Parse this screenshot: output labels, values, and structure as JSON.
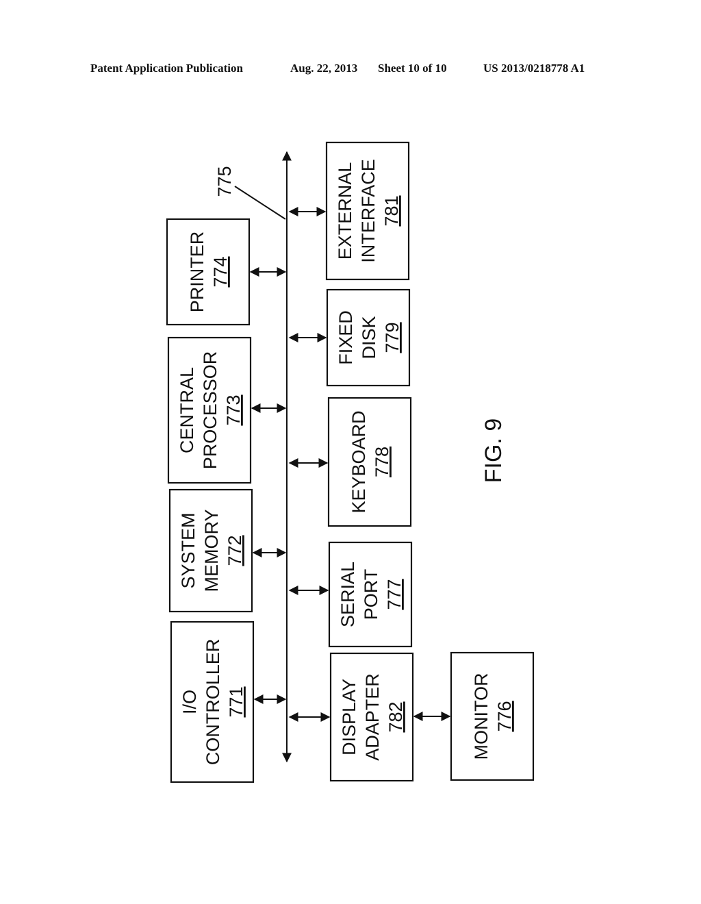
{
  "header": {
    "publication": "Patent Application Publication",
    "date": "Aug. 22, 2013",
    "sheet": "Sheet 10 of 10",
    "number": "US 2013/0218778 A1"
  },
  "figure": {
    "label": "FIG. 9",
    "bus_ref": "775",
    "components": [
      {
        "id": "io-controller",
        "lines": [
          "I/O",
          "CONTROLLER"
        ],
        "ref": "771",
        "side": "left"
      },
      {
        "id": "system-memory",
        "lines": [
          "SYSTEM",
          "MEMORY"
        ],
        "ref": "772",
        "side": "left"
      },
      {
        "id": "central-processor",
        "lines": [
          "CENTRAL",
          "PROCESSOR"
        ],
        "ref": "773",
        "side": "left"
      },
      {
        "id": "printer",
        "lines": [
          "PRINTER"
        ],
        "ref": "774",
        "side": "left"
      },
      {
        "id": "display-adapter",
        "lines": [
          "DISPLAY",
          "ADAPTER"
        ],
        "ref": "782",
        "side": "right"
      },
      {
        "id": "serial-port",
        "lines": [
          "SERIAL",
          "PORT"
        ],
        "ref": "777",
        "side": "right"
      },
      {
        "id": "keyboard",
        "lines": [
          "KEYBOARD"
        ],
        "ref": "778",
        "side": "right"
      },
      {
        "id": "fixed-disk",
        "lines": [
          "FIXED",
          "DISK"
        ],
        "ref": "779",
        "side": "right"
      },
      {
        "id": "external-interface",
        "lines": [
          "EXTERNAL",
          "INTERFACE"
        ],
        "ref": "781",
        "side": "right"
      },
      {
        "id": "monitor",
        "lines": [
          "MONITOR"
        ],
        "ref": "776",
        "side": "far-right"
      }
    ]
  }
}
